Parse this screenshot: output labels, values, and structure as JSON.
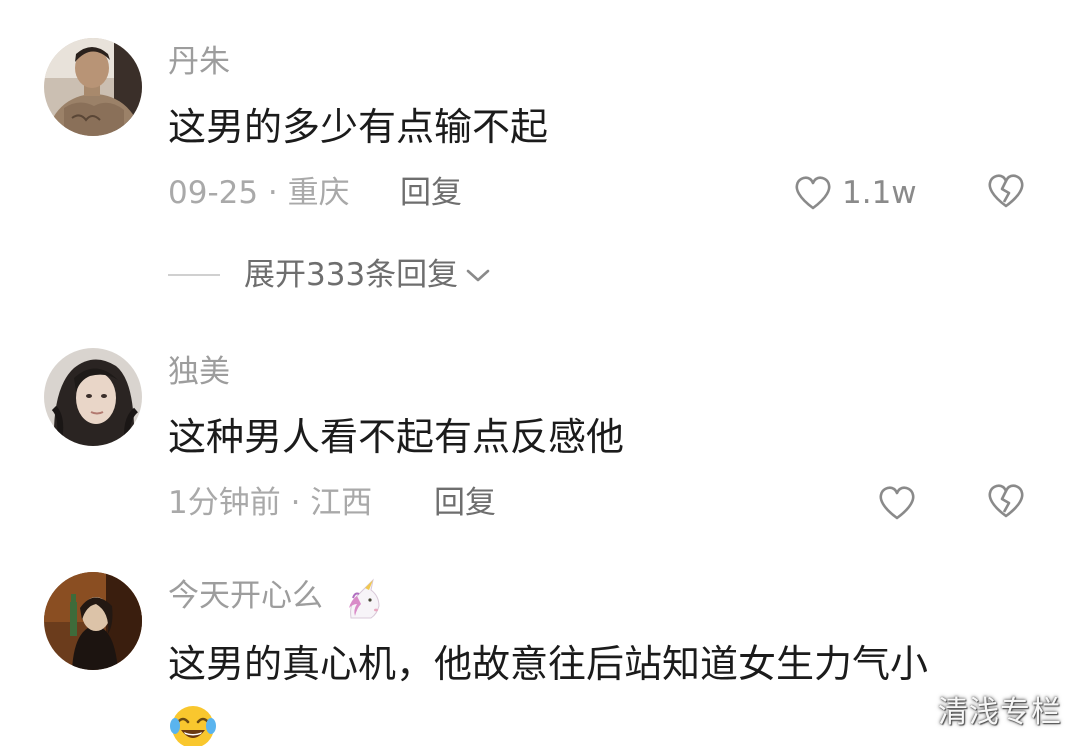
{
  "comments": [
    {
      "username": "丹朱",
      "text": "这男的多少有点输不起",
      "meta": "09-25 · 重庆",
      "reply_label": "回复",
      "like_count": "1.1w",
      "expand_label": "展开333条回复",
      "avatar_icon": "avatar-photo-man"
    },
    {
      "username": "独美",
      "text": "这种男人看不起有点反感他",
      "meta": "1分钟前 · 江西",
      "reply_label": "回复",
      "like_count": "",
      "avatar_icon": "avatar-photo-woman"
    },
    {
      "username": "今天开心么",
      "username_icon": "unicorn-emoji",
      "text": "这男的真心机，他故意往后站知道女生力气小",
      "emoji_icon": "crying-laughing-emoji",
      "avatar_icon": "avatar-photo-woman"
    }
  ],
  "watermark": "清浅专栏",
  "colors": {
    "username": "#9d9d9d",
    "text": "#1b1b1b",
    "meta": "#a9a9a9",
    "reply": "#6e6e6e",
    "icon_stroke": "#8a8a8a"
  }
}
